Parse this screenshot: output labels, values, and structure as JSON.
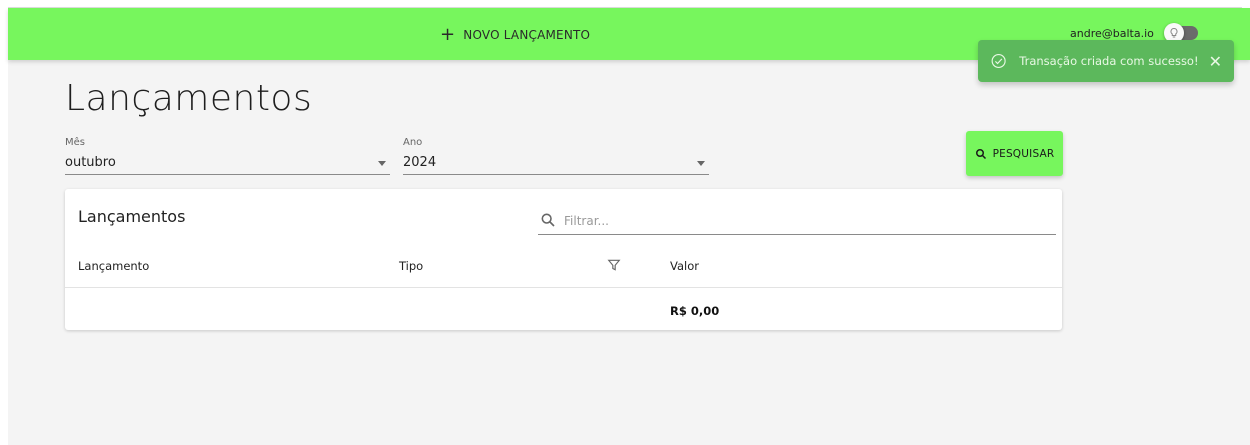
{
  "header": {
    "new_entry_label": "NOVO LANÇAMENTO",
    "user_email": "andre@balta.io",
    "accent_color": "#77f65d"
  },
  "toast": {
    "message": "Transação criada com sucesso!",
    "color": "#5cb85c"
  },
  "page": {
    "title": "Lançamentos"
  },
  "filters": {
    "month_label": "Mês",
    "month_value": "outubro",
    "year_label": "Ano",
    "year_value": "2024",
    "search_label": "PESQUISAR"
  },
  "table": {
    "title": "Lançamentos",
    "filter_placeholder": "Filtrar...",
    "columns": [
      "Lançamento",
      "Tipo",
      "Valor"
    ],
    "total": "R$ 0,00"
  },
  "icons": [
    "plus-icon",
    "lightbulb-icon",
    "check-circle-icon",
    "close-icon",
    "search-icon",
    "funnel-icon",
    "dropdown-caret-icon"
  ]
}
